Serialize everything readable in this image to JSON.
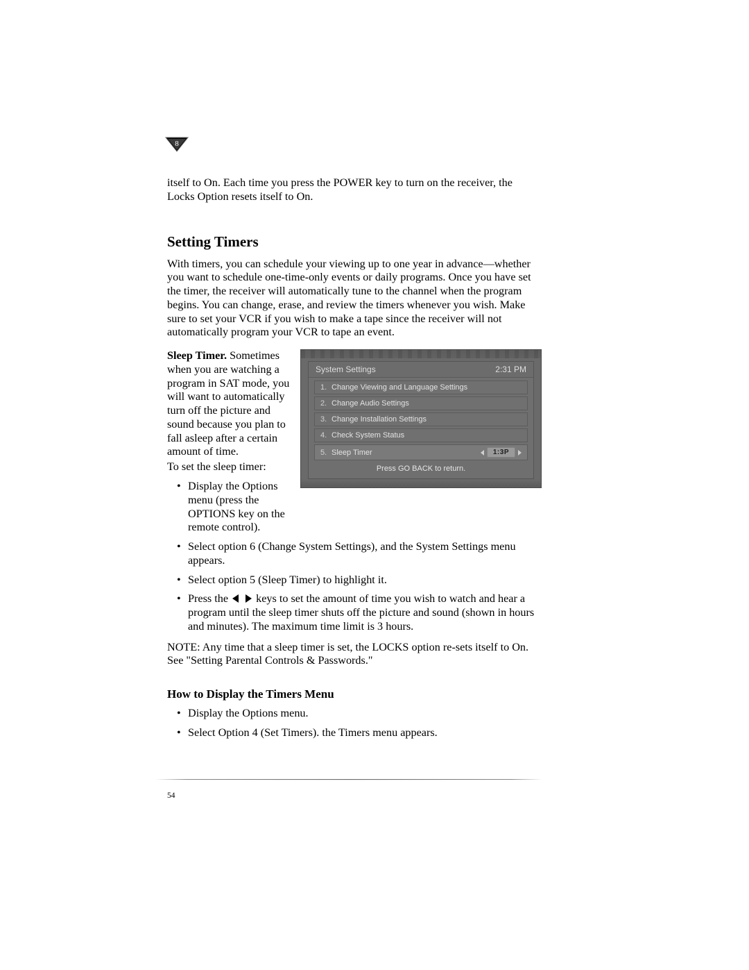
{
  "chapter_number": "8",
  "intro": "itself to On. Each time you press the POWER key to turn on the receiver, the Locks Option resets itself to On.",
  "heading": "Setting Timers",
  "p1": "With timers, you can schedule your viewing up to one year in advance—whether you want to schedule one-time-only events or daily programs. Once you have set the timer, the receiver will automatically tune to the channel when the program begins. You can change, erase, and review the timers whenever you wish. Make sure to set your VCR if you wish to make a tape since the receiver will not automatically program your VCR to tape an event.",
  "sleep_timer_label": "Sleep Timer.",
  "sleep_timer_body": " Sometimes when you are watching a program in SAT mode, you will want to automatically turn off the picture and sound because you plan to fall asleep after a certain amount of time.",
  "sleep_timer_lead": "To set the sleep timer:",
  "figure": {
    "title": "System Settings",
    "time": "2:31 PM",
    "items": [
      {
        "num": "1.",
        "label": "Change Viewing and Language Settings"
      },
      {
        "num": "2.",
        "label": "Change Audio Settings"
      },
      {
        "num": "3.",
        "label": "Change Installation Settings"
      },
      {
        "num": "4.",
        "label": "Check System Status"
      },
      {
        "num": "5.",
        "label": "Sleep Timer"
      }
    ],
    "value": "1:3P",
    "footer": "Press GO BACK to return."
  },
  "bullet_a": "Display the Options menu (press the OPTIONS key on the remote control).",
  "bullets_wide": [
    "Select option 6 (Change System Settings), and the System Settings menu appears.",
    "Select option 5 (Sleep Timer) to highlight it."
  ],
  "arrow_bullet_pre": "Press the ",
  "arrow_bullet_post": " keys to set the amount of time you wish to watch and hear a program until the sleep timer shuts off the picture and sound (shown in hours and minutes). The maximum time limit is 3 hours.",
  "note": "NOTE: Any time that a sleep timer is set, the LOCKS option re-sets itself to On. See \"Setting Parental Controls & Passwords.\"",
  "subheading": "How to Display the Timers Menu",
  "bullets2": [
    "Display the Options menu.",
    "Select Option 4 (Set Timers). the Timers menu appears."
  ],
  "page_number": "54"
}
